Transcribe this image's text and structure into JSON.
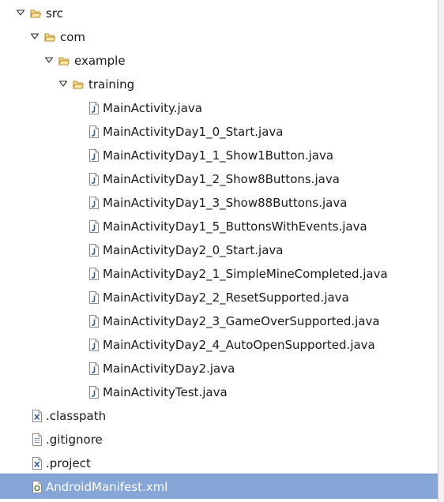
{
  "tree": {
    "items": [
      {
        "label": "src",
        "type": "folder"
      },
      {
        "label": "com",
        "type": "folder"
      },
      {
        "label": "example",
        "type": "folder"
      },
      {
        "label": "training",
        "type": "folder"
      },
      {
        "label": "MainActivity.java",
        "type": "java-file"
      },
      {
        "label": "MainActivityDay1_0_Start.java",
        "type": "java-file"
      },
      {
        "label": "MainActivityDay1_1_Show1Button.java",
        "type": "java-file"
      },
      {
        "label": "MainActivityDay1_2_Show8Buttons.java",
        "type": "java-file"
      },
      {
        "label": "MainActivityDay1_3_Show88Buttons.java",
        "type": "java-file"
      },
      {
        "label": "MainActivityDay1_5_ButtonsWithEvents.java",
        "type": "java-file"
      },
      {
        "label": "MainActivityDay2_0_Start.java",
        "type": "java-file"
      },
      {
        "label": "MainActivityDay2_1_SimpleMineCompleted.java",
        "type": "java-file"
      },
      {
        "label": "MainActivityDay2_2_ResetSupported.java",
        "type": "java-file"
      },
      {
        "label": "MainActivityDay2_3_GameOverSupported.java",
        "type": "java-file"
      },
      {
        "label": "MainActivityDay2_4_AutoOpenSupported.java",
        "type": "java-file"
      },
      {
        "label": "MainActivityDay2.java",
        "type": "java-file"
      },
      {
        "label": "MainActivityTest.java",
        "type": "java-file"
      },
      {
        "label": ".classpath",
        "type": "xml-file"
      },
      {
        "label": ".gitignore",
        "type": "text-file"
      },
      {
        "label": ".project",
        "type": "xml-file"
      },
      {
        "label": "AndroidManifest.xml",
        "type": "manifest-file",
        "selected": true
      }
    ]
  },
  "colors": {
    "selection_background": "#86a6d8",
    "selection_text": "#ffffff",
    "folder_fill": "#f7d98a",
    "folder_stroke": "#b88a2e",
    "java_icon_blue": "#2c5aa0"
  }
}
